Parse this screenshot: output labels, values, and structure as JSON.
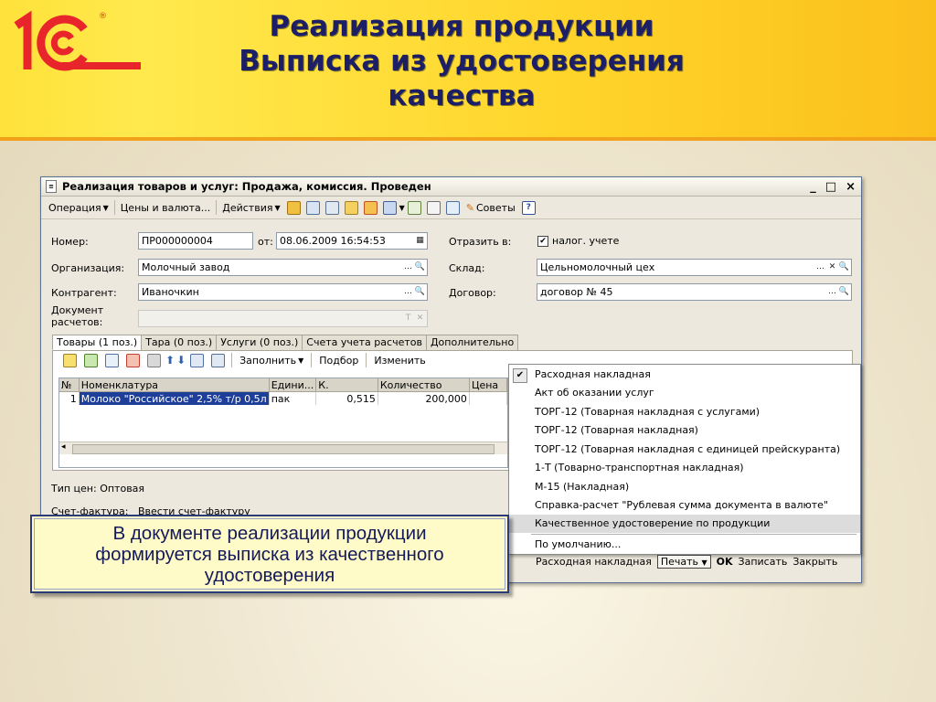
{
  "slide": {
    "title_lines": [
      "Реализация продукции",
      "Выписка из удостоверения",
      "качества"
    ],
    "logo_text": "1С",
    "note_lines": [
      "В документе реализации продукции",
      "формируется выписка из качественного",
      "удостоверения"
    ]
  },
  "window": {
    "title": "Реализация товаров и услуг: Продажа, комиссия. Проведен",
    "controls": [
      "_",
      "□",
      "×"
    ],
    "toolbar": {
      "operation": "Операция",
      "prices": "Цены и валюта...",
      "actions": "Действия",
      "tips": "Советы",
      "help": "?"
    }
  },
  "form": {
    "number_label": "Номер:",
    "number_value": "ПР000000004",
    "from_label": "от:",
    "date_value": "08.06.2009 16:54:53",
    "reflect_label": "Отразить в:",
    "reflect_checkbox": "налог. учете",
    "org_label": "Организация:",
    "org_value": "Молочный завод",
    "warehouse_label": "Склад:",
    "warehouse_value": "Цельномолочный цех",
    "contractor_label": "Контрагент:",
    "contractor_value": "Иваночкин",
    "contract_label": "Договор:",
    "contract_value": "договор № 45",
    "docsettle_label_1": "Документ",
    "docsettle_label_2": "расчетов:",
    "price_type": "Тип цен: Оптовая",
    "invoice_label": "Счет-фактура:",
    "invoice_link": "Ввести счет-фактуру"
  },
  "tabs": [
    "Товары (1 поз.)",
    "Тара (0 поз.)",
    "Услуги (0 поз.)",
    "Счета учета расчетов",
    "Дополнительно"
  ],
  "subtoolbar": {
    "fill": "Заполнить",
    "select": "Подбор",
    "change": "Изменить"
  },
  "table": {
    "columns": [
      "№",
      "Номенклатура",
      "Едини...",
      "К.",
      "Количество",
      "Цена"
    ],
    "rows": [
      [
        "1",
        "Молоко \"Российское\" 2,5% т/р 0,5л",
        "пак",
        "0,515",
        "200,000",
        ""
      ]
    ]
  },
  "print_menu": {
    "items": [
      "Расходная накладная",
      "Акт об оказании услуг",
      "ТОРГ-12 (Товарная накладная с услугами)",
      "ТОРГ-12 (Товарная накладная)",
      "ТОРГ-12 (Товарная накладная с единицей прейскуранта)",
      "1-Т (Товарно-транспортная накладная)",
      "М-15 (Накладная)",
      "Справка-расчет \"Рублевая сумма документа в валюте\"",
      "Качественное удостоверение по продукции"
    ],
    "default_item": "По умолчанию...",
    "checked_index": 0,
    "highlighted_index": 8
  },
  "bottom": {
    "waybill": "Расходная накладная",
    "print": "Печать",
    "ok": "OK",
    "save": "Записать",
    "close": "Закрыть"
  },
  "colors": {
    "header_yellow": "#ffd52b",
    "title_navy": "#1c1f66",
    "logo_red": "#e8252a",
    "selection_blue": "#1d3f9a",
    "note_bg": "#fffbc8"
  }
}
